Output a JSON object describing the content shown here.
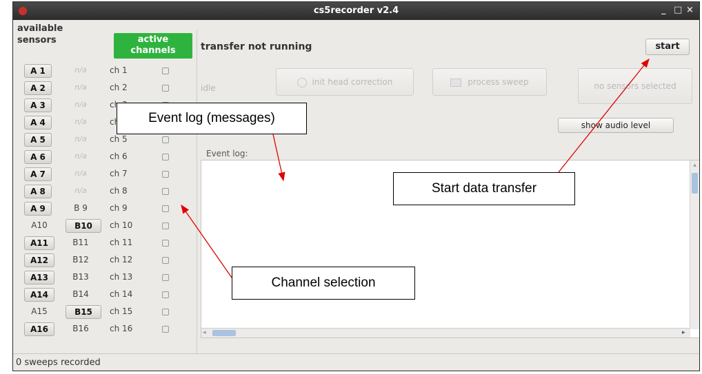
{
  "window": {
    "title": "cs5recorder v2.4",
    "controls": {
      "minimize": "_",
      "maximize": "□",
      "close": "×"
    }
  },
  "sidebar": {
    "header_available": "available sensors",
    "header_active": "active channels",
    "rows": [
      {
        "a": "A 1",
        "b": "n/a",
        "ch": "ch 1"
      },
      {
        "a": "A 2",
        "b": "n/a",
        "ch": "ch 2"
      },
      {
        "a": "A 3",
        "b": "n/a",
        "ch": "ch 3"
      },
      {
        "a": "A 4",
        "b": "n/a",
        "ch": "ch 4"
      },
      {
        "a": "A 5",
        "b": "n/a",
        "ch": "ch 5"
      },
      {
        "a": "A 6",
        "b": "n/a",
        "ch": "ch 6"
      },
      {
        "a": "A 7",
        "b": "n/a",
        "ch": "ch 7"
      },
      {
        "a": "A 8",
        "b": "n/a",
        "ch": "ch 8"
      },
      {
        "a": "A 9",
        "b": "B 9",
        "ch": "ch 9"
      },
      {
        "a": "A10",
        "b": "B10",
        "ch": "ch 10"
      },
      {
        "a": "A11",
        "b": "B11",
        "ch": "ch 11"
      },
      {
        "a": "A12",
        "b": "B12",
        "ch": "ch 12"
      },
      {
        "a": "A13",
        "b": "B13",
        "ch": "ch 13"
      },
      {
        "a": "A14",
        "b": "B14",
        "ch": "ch 14"
      },
      {
        "a": "A15",
        "b": "B15",
        "ch": "ch 15"
      },
      {
        "a": "A16",
        "b": "B16",
        "ch": "ch 16"
      }
    ]
  },
  "main": {
    "status": "transfer not running",
    "start_label": "start",
    "idle_label": "idle",
    "init_head_correction_label": "init head correction",
    "process_sweep_label": "process sweep",
    "no_sensors_label": "no sensors selected",
    "show_audio_label": "show audio level",
    "event_log_label": "Event log:"
  },
  "statusbar": {
    "text": "0 sweeps recorded"
  },
  "callouts": {
    "event_log": "Event log (messages)",
    "start_transfer": "Start data transfer",
    "channel_selection": "Channel selection"
  },
  "colors": {
    "active_channels_bg": "#2fb33f",
    "arrow": "#e00000"
  }
}
